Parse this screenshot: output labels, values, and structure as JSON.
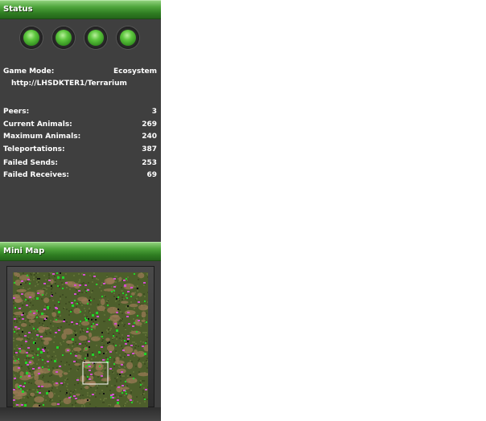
{
  "status": {
    "title": "Status",
    "lights": [
      "green-light",
      "green-light",
      "green-light",
      "green-light"
    ],
    "game_mode_label": "Game Mode:",
    "game_mode_value": "Ecosystem",
    "server_url": "http://LHSDKTER1/Terrarium",
    "stats": [
      {
        "label": "Peers:",
        "value": "3"
      },
      {
        "label": "Current Animals:",
        "value": "269"
      },
      {
        "label": "Maximum Animals:",
        "value": "240"
      },
      {
        "label": "Teleportations:",
        "value": "387"
      },
      {
        "label": "Failed Sends:",
        "value": "253"
      },
      {
        "label": "Failed Receives:",
        "value": "69"
      }
    ]
  },
  "minimap": {
    "title": "Mini Map"
  },
  "colors": {
    "header_green": "#4ea53b",
    "panel_bg": "#3f3f3f",
    "light_green": "#5dc63e",
    "plant_green": "#22d42a",
    "herbivore_magenta": "#d24fd0",
    "soil_tan": "#9a7a55",
    "grass": "#4d5e2b"
  }
}
